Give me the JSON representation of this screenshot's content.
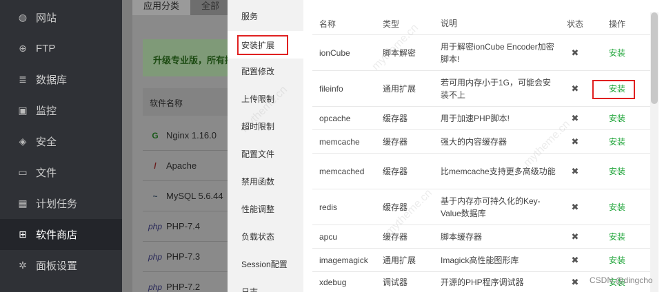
{
  "sidebar": {
    "items": [
      {
        "label": "网站",
        "icon": "globe-icon",
        "glyph": "◍"
      },
      {
        "label": "FTP",
        "icon": "ftp-icon",
        "glyph": "⊕"
      },
      {
        "label": "数据库",
        "icon": "database-icon",
        "glyph": "≣"
      },
      {
        "label": "监控",
        "icon": "monitor-icon",
        "glyph": "▣"
      },
      {
        "label": "安全",
        "icon": "shield-icon",
        "glyph": "◈"
      },
      {
        "label": "文件",
        "icon": "folder-icon",
        "glyph": "▭"
      },
      {
        "label": "计划任务",
        "icon": "calendar-icon",
        "glyph": "▦"
      },
      {
        "label": "软件商店",
        "icon": "grid-icon",
        "glyph": "⊞"
      },
      {
        "label": "面板设置",
        "icon": "gear-icon",
        "glyph": "✲"
      }
    ]
  },
  "background": {
    "tabs": [
      "应用分类",
      "全部"
    ],
    "upgrade_text": "升级专业版，所有插",
    "soft_header": "软件名称",
    "soft_rows": [
      {
        "name": "Nginx 1.16.0",
        "icon": "G"
      },
      {
        "name": "Apache",
        "icon": "/"
      },
      {
        "name": "MySQL 5.6.44",
        "icon": "~"
      },
      {
        "name": "PHP-7.4",
        "icon": "php"
      },
      {
        "name": "PHP-7.3",
        "icon": "php"
      },
      {
        "name": "PHP-7.2",
        "icon": "php"
      }
    ]
  },
  "modal": {
    "nav": [
      "服务",
      "安装扩展",
      "配置修改",
      "上传限制",
      "超时限制",
      "配置文件",
      "禁用函数",
      "性能调整",
      "负载状态",
      "Session配置",
      "日志"
    ],
    "active_nav": "安装扩展",
    "columns": [
      "名称",
      "类型",
      "说明",
      "状态",
      "操作"
    ],
    "rows": [
      {
        "name": "ionCube",
        "type": "脚本解密",
        "desc": "用于解密ionCube Encoder加密脚本!",
        "status": "✖",
        "action": "安装"
      },
      {
        "name": "fileinfo",
        "type": "通用扩展",
        "desc": "若可用内存小于1G，可能会安装不上",
        "status": "✖",
        "action": "安装"
      },
      {
        "name": "opcache",
        "type": "缓存器",
        "desc": "用于加速PHP脚本!",
        "status": "✖",
        "action": "安装"
      },
      {
        "name": "memcache",
        "type": "缓存器",
        "desc": "强大的内容缓存器",
        "status": "✖",
        "action": "安装"
      },
      {
        "name": "memcached",
        "type": "缓存器",
        "desc": "比memcache支持更多高级功能",
        "status": "✖",
        "action": "安装"
      },
      {
        "name": "redis",
        "type": "缓存器",
        "desc": "基于内存亦可持久化的Key-Value数据库",
        "status": "✖",
        "action": "安装"
      },
      {
        "name": "apcu",
        "type": "缓存器",
        "desc": "脚本缓存器",
        "status": "✖",
        "action": "安装"
      },
      {
        "name": "imagemagick",
        "type": "通用扩展",
        "desc": "Imagick高性能图形库",
        "status": "✖",
        "action": "安装"
      },
      {
        "name": "xdebug",
        "type": "调试器",
        "desc": "开源的PHP程序调试器",
        "status": "✖",
        "action": "安装"
      }
    ]
  },
  "watermark": "mytheme.cn",
  "credit": "CSDN @dingcho"
}
